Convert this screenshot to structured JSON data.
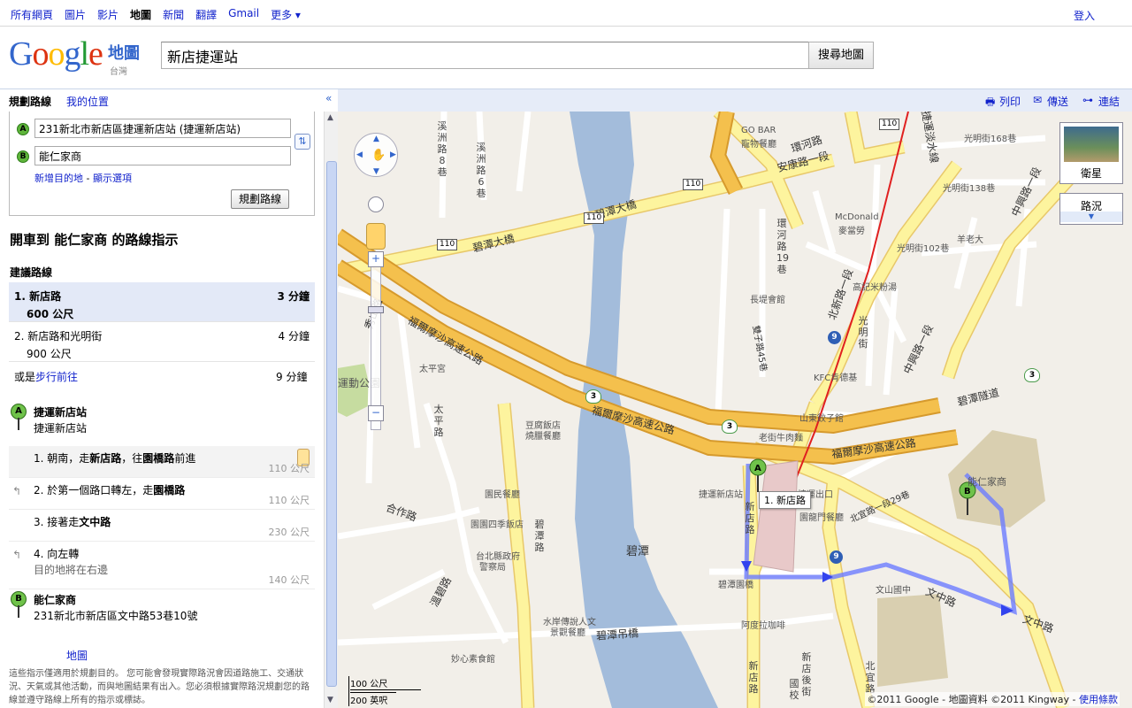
{
  "topnav": {
    "items": [
      "所有網頁",
      "圖片",
      "影片",
      "地圖",
      "新聞",
      "翻譯",
      "Gmail",
      "更多 ▾"
    ],
    "login": "登入"
  },
  "logo": {
    "sub": "地圖",
    "region": "台灣"
  },
  "search": {
    "value": "新店捷運站",
    "button": "搜尋地圖"
  },
  "sidebar_head": {
    "tab1": "規劃路線",
    "tab2": "我的位置",
    "collapse": "«"
  },
  "map_actions": {
    "print": "列印",
    "send": "傳送",
    "link": "連結"
  },
  "route_form": {
    "from": "231新北市新店區捷運新店站 (捷運新店站)",
    "to": "能仁家商",
    "marker_a": "A",
    "marker_b": "B",
    "add_dest": "新增目的地",
    "sep": " - ",
    "show_options": "顯示選項",
    "plan_button": "規劃路線"
  },
  "directions": {
    "title": "開車到 能仁家商 的路線指示",
    "routes_heading": "建議路線",
    "routes": [
      {
        "name": "1. 新店路",
        "distance": "600 公尺",
        "time": "3 分鐘"
      },
      {
        "name": "2. 新店路和光明街",
        "distance": "900 公尺",
        "time": "4 分鐘"
      }
    ],
    "walk_prefix": "或是",
    "walk_link": "步行前往",
    "walk_time": "9 分鐘",
    "start": {
      "title": "捷運新店站",
      "desc": "捷運新店站"
    },
    "steps": [
      {
        "html": "1. 朝南，走<b>新店路</b>，往<b>園橋路</b>前進",
        "sub": "",
        "dist": "110 公尺"
      },
      {
        "html": "2. 於第一個路口轉左，走<b>園橋路</b>",
        "sub": "",
        "dist": "110 公尺"
      },
      {
        "html": "3. 接著走<b>文中路</b>",
        "sub": "",
        "dist": "230 公尺"
      },
      {
        "html": "4. 向左轉",
        "sub": "目的地將在右邊",
        "dist": "140 公尺"
      }
    ],
    "end": {
      "title": "能仁家商",
      "desc": "231新北市新店區文中路53巷10號"
    }
  },
  "footer": {
    "map_link": "地圖",
    "disclaimer": "這些指示僅適用於規劃目的。 您可能會發現實際路況會因道路施工、交通狀況、天氣或其他活動，而與地圖結果有出入。您必須根據實際路況規劃您的路線並遵守路線上所有的指示或標誌。"
  },
  "map": {
    "satellite": "衛星",
    "traffic": "路況",
    "scale_m": "100 公尺",
    "scale_ft": "200 英呎",
    "copyright": "©2011 Google - 地圖資料 ©2011 Kingway - ",
    "terms": "使用條款",
    "step_label": "1. 新店路",
    "labels": {
      "gobar": "GO BAR",
      "gobar2": "寵物餐廳",
      "huanhe": "環河路",
      "anken": "安康路一段",
      "jietan": "捷運淡水線",
      "guangming168": "光明街168巷",
      "guangming138": "光明街138巷",
      "guangming102": "光明街102巷",
      "yanglaoda": "羊老大",
      "mcd": "McDonald",
      "mcd2": "麥當勞",
      "bitan_bridge": "碧潭大橋",
      "bitan_bridge2": "碧潭大橋",
      "xizhou8": "溪洲路8巷",
      "xizhou6": "溪洲路6巷",
      "fuer1": "福爾摩沙高速公路",
      "fuer2": "福爾摩沙高速公路",
      "fuer3": "福爾摩沙高速公路",
      "changyuan": "長堤會館",
      "gaoji": "高記米粉湯",
      "kfc": "KFC肯德基",
      "shandong": "山東餃子館",
      "laojie": "老街牛肉麵",
      "jietan_exit": "捷運出口",
      "mrt_station": "捷運新店站",
      "yuanlong": "園龍門餐廳",
      "beiyi29": "北宜路一段29巷",
      "yuangmin": "園民餐廳",
      "taiping": "太平宮",
      "xiuhshan": "秀山路",
      "yundong": "運動公園",
      "taipinglu": "太平路",
      "douyuan": "豆腐飯店",
      "douyuan2": "燒臘餐廳",
      "bitanroad": "碧潭路",
      "hezuo": "合作路",
      "lizhiroad": "溫碧路",
      "taibei_county": "台北縣政府",
      "taibei_police": "警察局",
      "yuansi": "園園四季飯店",
      "bitan_lake": "碧潭",
      "shuian": "水岸傳說人文",
      "shuian2": "景觀餐廳",
      "miaoxin": "妙心素食館",
      "bitandiao": "碧潭吊橋",
      "xindian_rd": "新店路",
      "xindian_rd2": "新店路",
      "wenshan": "文山國中",
      "wenzhong": "文中路",
      "wenzhong2": "文中路",
      "beiyilu": "北宜路",
      "nengren": "能仁家商",
      "guangming": "光明街",
      "zhongxing": "中興路一段",
      "zhongxing2": "中興路一段",
      "beixin": "北新路一段",
      "bitan_tunnel": "碧潭隧道",
      "xintan": "新店後街",
      "guoshu": "國校",
      "ahezhi": "阿度拉咖啡",
      "bitan_yuanqiao": "碧潭園橋",
      "huanhe19": "環河路19巷",
      "shuangliu": "雙子路45巷",
      "shield110": "110",
      "shield3": "3",
      "shield9": "9",
      "marker_a": "A",
      "marker_b": "B"
    }
  },
  "colors": {
    "highway": "#f4c04d",
    "highway_edge": "#d69a2d",
    "major_road": "#fdf49e",
    "water": "#a3bcdb",
    "park": "#c6dca0",
    "route": "#6b7cff",
    "link": "#1122cc"
  }
}
